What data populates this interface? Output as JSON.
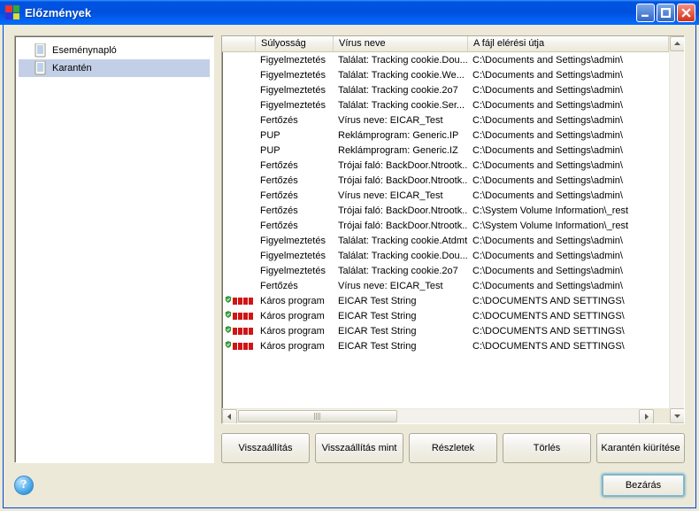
{
  "window": {
    "title": "Előzmények"
  },
  "tree": {
    "items": [
      {
        "label": "Eseménynapló",
        "selected": false
      },
      {
        "label": "Karantén",
        "selected": true
      }
    ]
  },
  "columns": {
    "severity": "Súlyosság",
    "virus": "Vírus neve",
    "path": "A fájl elérési útja"
  },
  "rows": [
    {
      "sev": "",
      "icon": "none",
      "virus": "Figyelmeztetés",
      "name": "Találat: Tracking cookie.Dou...",
      "path": "C:\\Documents and Settings\\admin\\"
    },
    {
      "sev": "",
      "icon": "none",
      "virus": "Figyelmeztetés",
      "name": "Találat: Tracking cookie.We...",
      "path": "C:\\Documents and Settings\\admin\\"
    },
    {
      "sev": "",
      "icon": "none",
      "virus": "Figyelmeztetés",
      "name": "Találat: Tracking cookie.2o7",
      "path": "C:\\Documents and Settings\\admin\\"
    },
    {
      "sev": "",
      "icon": "none",
      "virus": "Figyelmeztetés",
      "name": "Találat: Tracking cookie.Ser...",
      "path": "C:\\Documents and Settings\\admin\\"
    },
    {
      "sev": "",
      "icon": "none",
      "virus": "Fertőzés",
      "name": "Vírus neve: EICAR_Test",
      "path": "C:\\Documents and Settings\\admin\\"
    },
    {
      "sev": "",
      "icon": "none",
      "virus": "PUP",
      "name": "Reklámprogram: Generic.IP",
      "path": "C:\\Documents and Settings\\admin\\"
    },
    {
      "sev": "",
      "icon": "none",
      "virus": "PUP",
      "name": "Reklámprogram: Generic.IZ",
      "path": "C:\\Documents and Settings\\admin\\"
    },
    {
      "sev": "",
      "icon": "none",
      "virus": "Fertőzés",
      "name": "Trójai faló: BackDoor.Ntrootk...",
      "path": "C:\\Documents and Settings\\admin\\"
    },
    {
      "sev": "",
      "icon": "none",
      "virus": "Fertőzés",
      "name": "Trójai faló: BackDoor.Ntrootk...",
      "path": "C:\\Documents and Settings\\admin\\"
    },
    {
      "sev": "",
      "icon": "none",
      "virus": "Fertőzés",
      "name": "Vírus neve: EICAR_Test",
      "path": "C:\\Documents and Settings\\admin\\"
    },
    {
      "sev": "",
      "icon": "none",
      "virus": "Fertőzés",
      "name": "Trójai faló: BackDoor.Ntrootk...",
      "path": "C:\\System Volume Information\\_rest"
    },
    {
      "sev": "",
      "icon": "none",
      "virus": "Fertőzés",
      "name": "Trójai faló: BackDoor.Ntrootk...",
      "path": "C:\\System Volume Information\\_rest"
    },
    {
      "sev": "",
      "icon": "none",
      "virus": "Figyelmeztetés",
      "name": "Találat: Tracking cookie.Atdmt",
      "path": "C:\\Documents and Settings\\admin\\"
    },
    {
      "sev": "",
      "icon": "none",
      "virus": "Figyelmeztetés",
      "name": "Találat: Tracking cookie.Dou...",
      "path": "C:\\Documents and Settings\\admin\\"
    },
    {
      "sev": "",
      "icon": "none",
      "virus": "Figyelmeztetés",
      "name": "Találat: Tracking cookie.2o7",
      "path": "C:\\Documents and Settings\\admin\\"
    },
    {
      "sev": "",
      "icon": "none",
      "virus": "Fertőzés",
      "name": "Vírus neve: EICAR_Test",
      "path": "C:\\Documents and Settings\\admin\\"
    },
    {
      "sev": "high",
      "icon": "shield",
      "virus": "Káros program",
      "name": "EICAR Test String",
      "path": "C:\\DOCUMENTS AND SETTINGS\\"
    },
    {
      "sev": "high",
      "icon": "shield",
      "virus": "Káros program",
      "name": "EICAR Test String",
      "path": "C:\\DOCUMENTS AND SETTINGS\\"
    },
    {
      "sev": "high",
      "icon": "shield",
      "virus": "Káros program",
      "name": "EICAR Test String",
      "path": "C:\\DOCUMENTS AND SETTINGS\\"
    },
    {
      "sev": "high",
      "icon": "shield",
      "virus": "Káros program",
      "name": "EICAR Test String",
      "path": "C:\\DOCUMENTS AND SETTINGS\\"
    }
  ],
  "buttons": {
    "restore": "Visszaállítás",
    "restore_as": "Visszaállítás mint",
    "details": "Részletek",
    "delete": "Törlés",
    "empty_quarantine": "Karantén kiürítése"
  },
  "footer": {
    "close": "Bezárás"
  }
}
